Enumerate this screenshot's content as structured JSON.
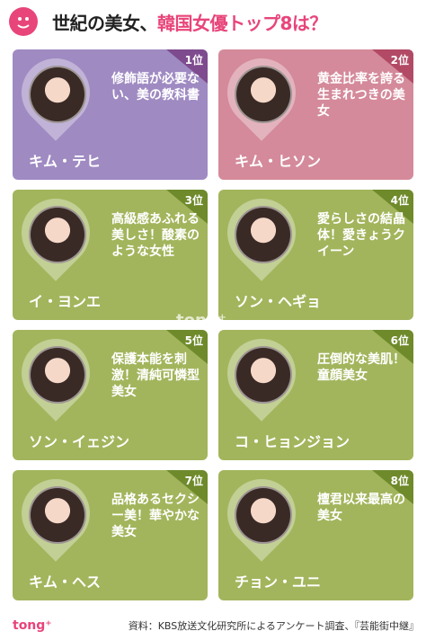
{
  "header": {
    "title_prefix": "世紀の美女、",
    "title_highlight": "韓国女優トップ8は？"
  },
  "cards": [
    {
      "rank": "1位",
      "name": "キム・テヒ",
      "text": "修飾語が必要ない、美の教科書",
      "color": "#9f8ac2"
    },
    {
      "rank": "2位",
      "name": "キム・ヒソン",
      "text": "黄金比率を誇る生まれつきの美女",
      "color": "#d48a9a"
    },
    {
      "rank": "3位",
      "name": "イ・ヨンエ",
      "text": "高級感あふれる美しさ！酸素のような女性",
      "color": "#a2b55c"
    },
    {
      "rank": "4位",
      "name": "ソン・ヘギョ",
      "text": "愛らしさの結晶体！愛きょうクイーン",
      "color": "#a2b55c"
    },
    {
      "rank": "5位",
      "name": "ソン・イェジン",
      "text": "保護本能を刺激！清純可憐型美女",
      "color": "#a2b55c"
    },
    {
      "rank": "6位",
      "name": "コ・ヒョンジョン",
      "text": "圧倒的な美肌！童顔美女",
      "color": "#a2b55c"
    },
    {
      "rank": "7位",
      "name": "キム・ヘス",
      "text": "品格あるセクシー美！華やかな美女",
      "color": "#a2b55c"
    },
    {
      "rank": "8位",
      "name": "チョン・ユニ",
      "text": "檀君以来最高の美女",
      "color": "#a2b55c"
    }
  ],
  "watermark": "tong⁺",
  "footer": {
    "logo": "tong⁺",
    "note": "資料：KBS放送文化研究所によるアンケート調査、『芸能街中継』"
  }
}
